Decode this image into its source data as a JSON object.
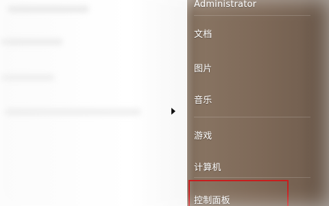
{
  "start_menu": {
    "right_pane": {
      "items": [
        {
          "label": "Administrator"
        },
        {
          "label": "文档"
        },
        {
          "label": "图片"
        },
        {
          "label": "音乐"
        },
        {
          "label": "游戏"
        },
        {
          "label": "计算机"
        },
        {
          "label": "控制面板"
        }
      ]
    }
  },
  "colors": {
    "highlight_border": "#c81d1d",
    "panel_brown": "#7d6857"
  },
  "icons": {
    "expand_arrow": "chevron-right-icon"
  }
}
